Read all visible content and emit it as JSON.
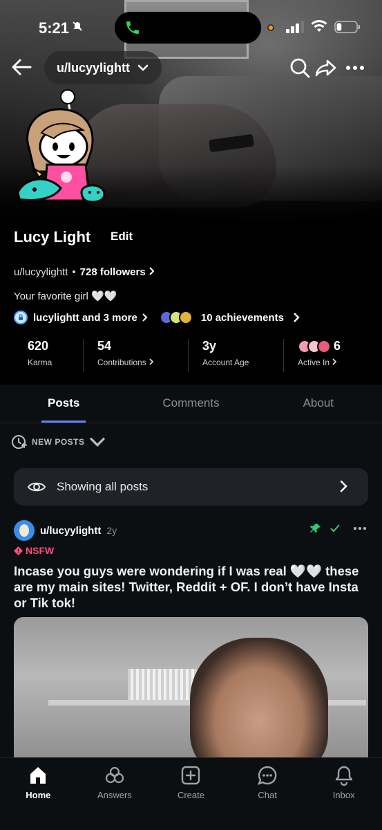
{
  "status_bar": {
    "time": "5:21",
    "battery_level": 0.25
  },
  "nav": {
    "username_pill": "u/lucyylightt"
  },
  "profile": {
    "display_name": "Lucy Light",
    "edit_label": "Edit",
    "username": "u/lucyylightt",
    "separator": "•",
    "followers": "728 followers",
    "bio": "Your favorite girl 🤍🤍",
    "social_links": "lucylightt and 3 more",
    "achievements": "10 achievements"
  },
  "stats": [
    {
      "value": "620",
      "label": "Karma",
      "arrow": false
    },
    {
      "value": "54",
      "label": "Contributions",
      "arrow": true
    },
    {
      "value": "3y",
      "label": "Account Age",
      "arrow": false
    },
    {
      "value": "6",
      "label": "Active In",
      "arrow": true
    }
  ],
  "tabs": [
    {
      "label": "Posts",
      "active": true
    },
    {
      "label": "Comments",
      "active": false
    },
    {
      "label": "About",
      "active": false
    }
  ],
  "sort": {
    "label": "NEW POSTS"
  },
  "filter": {
    "label": "Showing all posts"
  },
  "post": {
    "user": "u/lucyylightt",
    "age": "2y",
    "nsfw_label": "NSFW",
    "title": "Incase you guys were wondering if I was real 🤍🤍 these are my main sites! Twitter, Reddit + OF. I don’t have Insta or Tik tok!"
  },
  "bottom_nav": [
    {
      "label": "Home",
      "icon": "home-icon",
      "active": true
    },
    {
      "label": "Answers",
      "icon": "answers-icon",
      "active": false
    },
    {
      "label": "Create",
      "icon": "create-icon",
      "active": false
    },
    {
      "label": "Chat",
      "icon": "chat-icon",
      "active": false
    },
    {
      "label": "Inbox",
      "icon": "bell-icon",
      "active": false
    }
  ],
  "colors": {
    "accent": "#5f86ff",
    "nsfw": "#ff4b7a",
    "mod_green": "#2ecc71"
  }
}
